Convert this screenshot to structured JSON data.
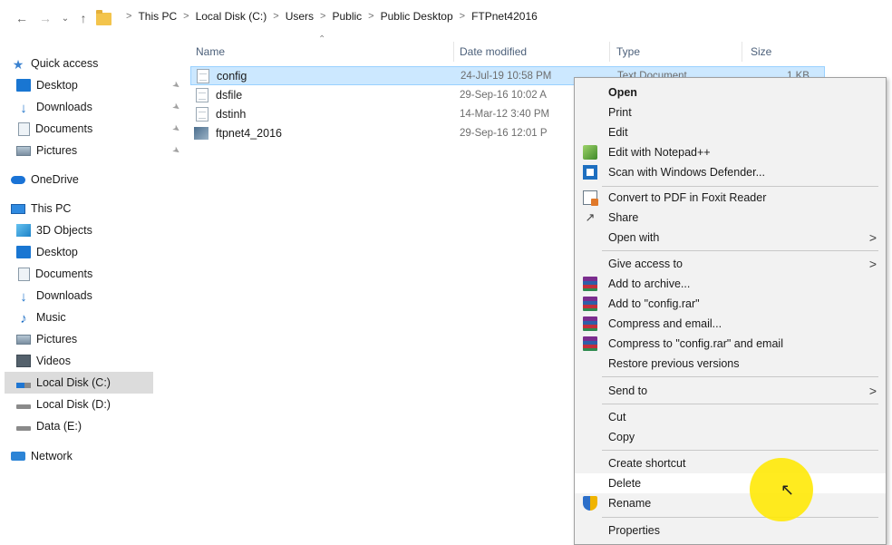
{
  "address_bar": {
    "crumbs": [
      "This PC",
      "Local Disk (C:)",
      "Users",
      "Public",
      "Public Desktop",
      "FTPnet42016"
    ],
    "separator": ">"
  },
  "navigation_pane": {
    "quick_access": {
      "label": "Quick access",
      "items": [
        {
          "label": "Desktop",
          "icon": "desktop-icon",
          "pinned": true
        },
        {
          "label": "Downloads",
          "icon": "downloads-icon",
          "pinned": true
        },
        {
          "label": "Documents",
          "icon": "documents-icon",
          "pinned": true
        },
        {
          "label": "Pictures",
          "icon": "pictures-icon",
          "pinned": true
        }
      ]
    },
    "onedrive": "OneDrive",
    "this_pc": {
      "label": "This PC",
      "items": [
        {
          "label": "3D Objects",
          "icon": "3d-objects-icon"
        },
        {
          "label": "Desktop",
          "icon": "desktop-icon"
        },
        {
          "label": "Documents",
          "icon": "documents-icon"
        },
        {
          "label": "Downloads",
          "icon": "downloads-icon"
        },
        {
          "label": "Music",
          "icon": "music-icon"
        },
        {
          "label": "Pictures",
          "icon": "pictures-icon"
        },
        {
          "label": "Videos",
          "icon": "videos-icon"
        },
        {
          "label": "Local Disk (C:)",
          "icon": "drive-c-icon",
          "selected": true
        },
        {
          "label": "Local Disk (D:)",
          "icon": "drive-icon"
        },
        {
          "label": "Data (E:)",
          "icon": "drive-icon"
        }
      ]
    },
    "network": "Network"
  },
  "file_list": {
    "columns": {
      "name": "Name",
      "date": "Date modified",
      "type": "Type",
      "size": "Size"
    },
    "rows": [
      {
        "name": "config",
        "date": "24-Jul-19 10:58 PM",
        "type": "Text Document",
        "size": "1 KB",
        "icon": "text-file-icon",
        "selected": true
      },
      {
        "name": "dsfile",
        "date": "29-Sep-16 10:02 A",
        "type": "",
        "size": "",
        "icon": "file-icon"
      },
      {
        "name": "dstinh",
        "date": "14-Mar-12 3:40 PM",
        "type": "",
        "size": "",
        "icon": "file-icon"
      },
      {
        "name": "ftpnet4_2016",
        "date": "29-Sep-16 12:01 P",
        "type": "",
        "size": "",
        "icon": "application-icon"
      }
    ]
  },
  "context_menu": {
    "items": {
      "open": "Open",
      "print": "Print",
      "edit": "Edit",
      "edit_notepad": "Edit with Notepad++",
      "scan_defender": "Scan with Windows Defender...",
      "convert_pdf": "Convert to PDF in Foxit Reader",
      "share": "Share",
      "open_with": "Open with",
      "give_access": "Give access to",
      "add_archive": "Add to archive...",
      "add_rar": "Add to \"config.rar\"",
      "compress_email": "Compress and email...",
      "compress_rar_email": "Compress to \"config.rar\" and email",
      "restore_versions": "Restore previous versions",
      "send_to": "Send to",
      "cut": "Cut",
      "copy": "Copy",
      "create_shortcut": "Create shortcut",
      "delete": "Delete",
      "rename": "Rename",
      "properties": "Properties"
    },
    "hovered": "Delete",
    "submenu_arrow": ">"
  },
  "colors": {
    "selection": "#cce8ff",
    "menu_bg": "#f2f2f2",
    "cursor_highlight": "#ffe800"
  }
}
